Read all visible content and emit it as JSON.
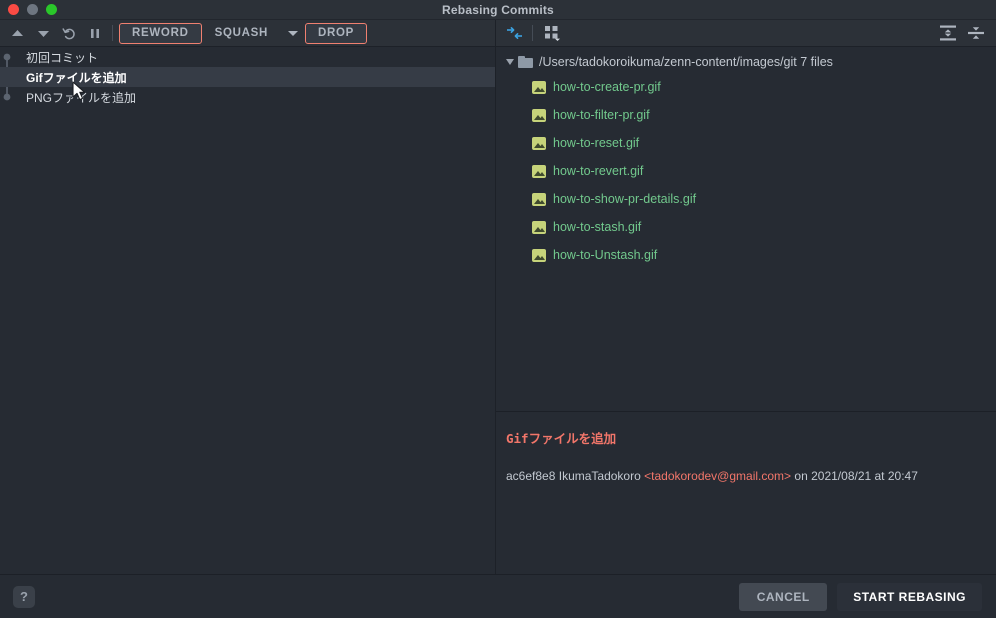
{
  "window": {
    "title": "Rebasing Commits",
    "traffic_lights": [
      "close-red",
      "minimize-gray",
      "maximize-green"
    ]
  },
  "left_toolbar": {
    "icons": [
      {
        "name": "move-up-icon",
        "glyph": "▲"
      },
      {
        "name": "move-down-icon",
        "glyph": "▼"
      },
      {
        "name": "undo-icon",
        "glyph": "↺"
      },
      {
        "name": "pause-icon",
        "glyph": "❙❙"
      }
    ],
    "reword_label": "REWORD",
    "squash_label": "SQUASH",
    "drop_label": "DROP",
    "accent_outline": "#f08070"
  },
  "commit_list": {
    "rows": [
      {
        "label": "初回コミット",
        "selected": false
      },
      {
        "label": "Gifファイルを追加",
        "selected": true
      },
      {
        "label": "PNGファイルを追加",
        "selected": false
      }
    ]
  },
  "right_toolbar": {
    "compare_icon": "collapse-arrows-icon",
    "layout_icon": "grid-layout-icon",
    "expand_all_icon": "expand-all-icon",
    "collapse_all_icon": "collapse-all-icon",
    "accent_blue": "#3ba2e0"
  },
  "file_tree": {
    "folder_path": "/Users/tadokoroikuma/zenn-content/images/git",
    "folder_count": "7 files",
    "files": [
      {
        "name": "how-to-create-pr.gif"
      },
      {
        "name": "how-to-filter-pr.gif"
      },
      {
        "name": "how-to-reset.gif"
      },
      {
        "name": "how-to-revert.gif"
      },
      {
        "name": "how-to-show-pr-details.gif"
      },
      {
        "name": "how-to-stash.gif"
      },
      {
        "name": "how-to-Unstash.gif"
      }
    ],
    "file_color": "#72c98d"
  },
  "commit_detail": {
    "subject": "Gifファイルを追加",
    "hash": "ac6ef8e8",
    "author": "IkumaTadokoro",
    "email": "<tadokorodev@gmail.com>",
    "date_prefix": "on",
    "date": "2021/08/21 at 20:47",
    "accent": "#f2766a"
  },
  "footer": {
    "help_label": "?",
    "cancel_label": "CANCEL",
    "start_label": "START REBASING"
  }
}
